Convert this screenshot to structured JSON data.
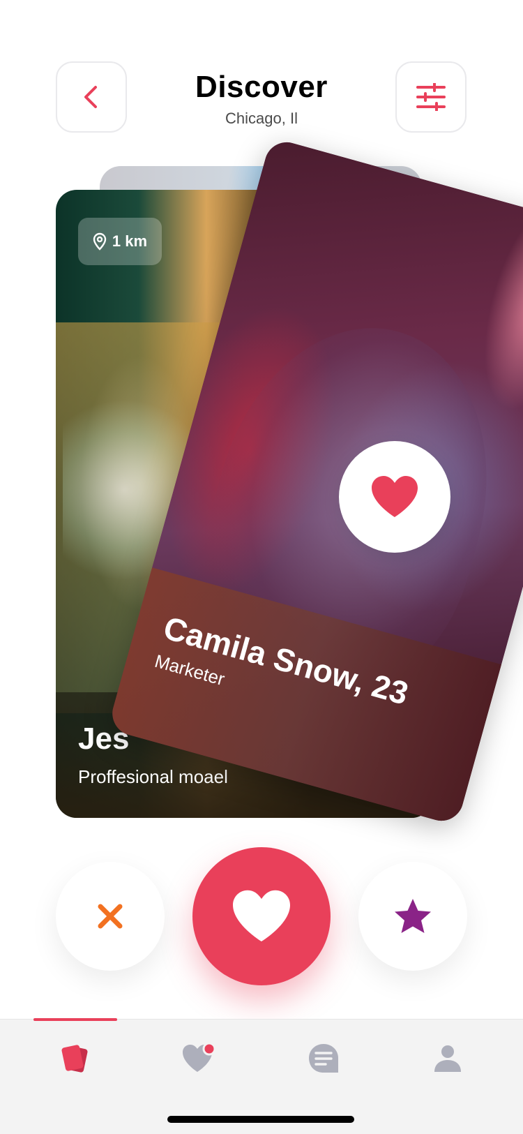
{
  "header": {
    "title": "Discover",
    "location": "Chicago, Il"
  },
  "cards": {
    "front": {
      "name": "Camila Snow, 23",
      "job": "Marketer"
    },
    "behind": {
      "distance": "1 km",
      "name_visible": "Jes",
      "job_visible": "Proffesional moael"
    }
  },
  "colors": {
    "accent": "#e9405a",
    "dislike": "#f27121",
    "superlike": "#8a2387",
    "tab_inactive": "#adafbb"
  },
  "actions": {
    "dislike_icon": "close-icon",
    "like_icon": "heart-icon",
    "superlike_icon": "star-icon"
  },
  "tabs": [
    {
      "icon": "cards-icon",
      "active": true
    },
    {
      "icon": "heart-notification-icon",
      "active": false
    },
    {
      "icon": "chat-icon",
      "active": false
    },
    {
      "icon": "user-icon",
      "active": false
    }
  ]
}
